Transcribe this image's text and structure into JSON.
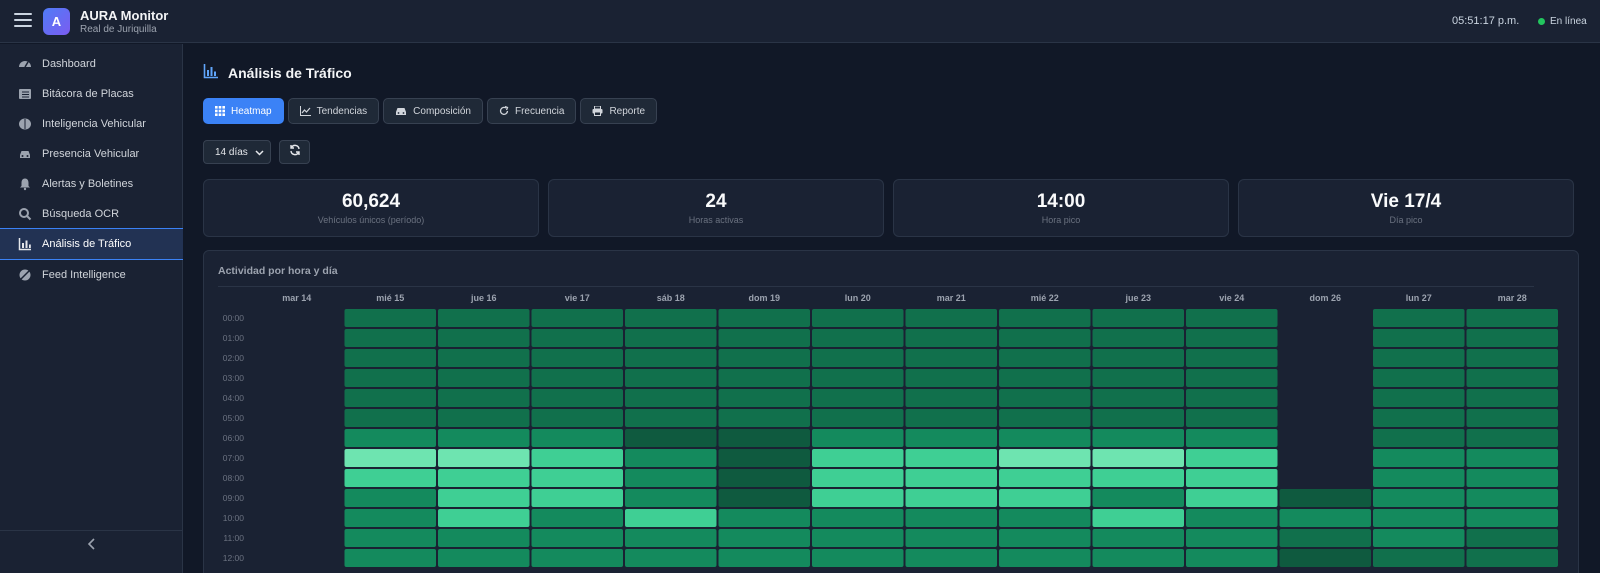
{
  "header": {
    "logo_letter": "A",
    "app_title": "AURA Monitor",
    "app_subtitle": "Real de Juriquilla",
    "clock": "05:51:17 p.m.",
    "status": "En línea"
  },
  "sidebar": {
    "items": [
      {
        "label": "Dashboard",
        "icon": "gauge-icon"
      },
      {
        "label": "Bitácora de Placas",
        "icon": "list-icon"
      },
      {
        "label": "Inteligencia Vehicular",
        "icon": "brain-icon"
      },
      {
        "label": "Presencia Vehicular",
        "icon": "car-icon"
      },
      {
        "label": "Alertas y Boletines",
        "icon": "bell-icon"
      },
      {
        "label": "Búsqueda OCR",
        "icon": "search-icon"
      },
      {
        "label": "Análisis de Tráfico",
        "icon": "chart-bar-icon",
        "active": true
      },
      {
        "label": "Feed Intelligence",
        "icon": "satellite-icon"
      }
    ]
  },
  "page": {
    "title": "Análisis de Tráfico",
    "tabs": [
      {
        "label": "Heatmap",
        "icon": "grid-icon",
        "active": true
      },
      {
        "label": "Tendencias",
        "icon": "line-chart-icon"
      },
      {
        "label": "Composición",
        "icon": "car-icon"
      },
      {
        "label": "Frecuencia",
        "icon": "redo-icon"
      },
      {
        "label": "Reporte",
        "icon": "print-icon"
      }
    ],
    "period_select": "14 días",
    "stats": [
      {
        "value": "60,624",
        "label": "Vehículos únicos (período)"
      },
      {
        "value": "24",
        "label": "Horas activas"
      },
      {
        "value": "14:00",
        "label": "Hora pico"
      },
      {
        "value": "Vie 17/4",
        "label": "Día pico"
      }
    ],
    "heatmap_title": "Actividad por hora y día"
  },
  "colors": {
    "accent": "#3b82f6",
    "online": "#22c55e",
    "heat_levels": [
      "#1a2233",
      "#0f5a3f",
      "#11704c",
      "#148a5d",
      "#27b27b",
      "#3fcf94",
      "#6ee4b0"
    ]
  },
  "chart_data": {
    "type": "heatmap",
    "title": "Actividad por hora y día",
    "x": [
      "mar 14",
      "mié 15",
      "jue 16",
      "vie 17",
      "sáb 18",
      "dom 19",
      "lun 20",
      "mar 21",
      "mié 22",
      "jue 23",
      "vie 24",
      "dom 26",
      "lun 27",
      "mar 28"
    ],
    "y": [
      "00:00",
      "01:00",
      "02:00",
      "03:00",
      "04:00",
      "05:00",
      "06:00",
      "07:00",
      "08:00",
      "09:00",
      "10:00",
      "11:00",
      "12:00"
    ],
    "intensity_levels": "0 = sin datos, 1 (bajo) a 6 (alto)",
    "values": [
      [
        0,
        2,
        2,
        2,
        2,
        2,
        2,
        2,
        2,
        2,
        2,
        0,
        2,
        2
      ],
      [
        0,
        2,
        2,
        2,
        2,
        2,
        2,
        2,
        2,
        2,
        2,
        0,
        2,
        2
      ],
      [
        0,
        2,
        2,
        2,
        2,
        2,
        2,
        2,
        2,
        2,
        2,
        0,
        2,
        2
      ],
      [
        0,
        2,
        2,
        2,
        2,
        2,
        2,
        2,
        2,
        2,
        2,
        0,
        2,
        2
      ],
      [
        0,
        2,
        2,
        2,
        2,
        2,
        2,
        2,
        2,
        2,
        2,
        0,
        2,
        2
      ],
      [
        0,
        2,
        2,
        2,
        2,
        2,
        2,
        2,
        2,
        2,
        2,
        0,
        2,
        2
      ],
      [
        0,
        3,
        3,
        3,
        1,
        1,
        3,
        3,
        3,
        3,
        3,
        0,
        2,
        2
      ],
      [
        0,
        6,
        6,
        5,
        3,
        1,
        5,
        5,
        6,
        6,
        5,
        0,
        3,
        3
      ],
      [
        0,
        5,
        5,
        5,
        3,
        1,
        5,
        5,
        5,
        5,
        5,
        0,
        3,
        3
      ],
      [
        0,
        3,
        5,
        5,
        3,
        1,
        5,
        5,
        5,
        3,
        5,
        1,
        3,
        3
      ],
      [
        0,
        3,
        5,
        3,
        5,
        3,
        3,
        3,
        3,
        5,
        3,
        3,
        3,
        3
      ],
      [
        0,
        3,
        3,
        3,
        3,
        3,
        3,
        3,
        3,
        3,
        3,
        2,
        3,
        2
      ],
      [
        0,
        3,
        3,
        3,
        3,
        3,
        3,
        3,
        3,
        3,
        3,
        1,
        2,
        2
      ]
    ]
  }
}
